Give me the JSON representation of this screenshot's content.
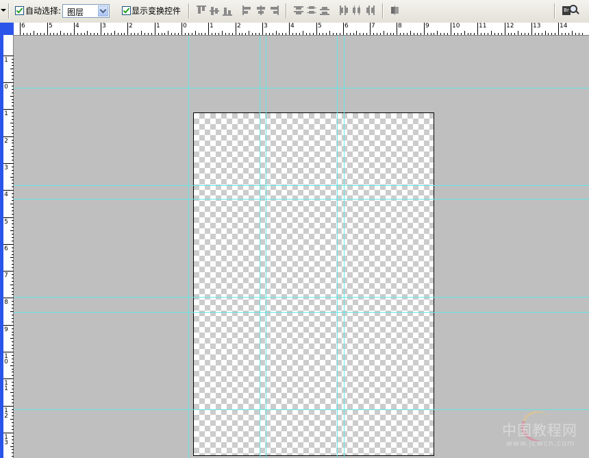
{
  "options_bar": {
    "auto_select": {
      "label": "自动选择:",
      "checked": true
    },
    "auto_select_target": {
      "value": "图层"
    },
    "show_transform_controls": {
      "label": "显示变换控件",
      "checked": true
    },
    "align_buttons": [
      "align-top-edges-icon",
      "align-vertical-centers-icon",
      "align-bottom-edges-icon",
      "align-left-edges-icon",
      "align-horizontal-centers-icon",
      "align-right-edges-icon"
    ],
    "distribute_buttons": [
      "distribute-top-icon",
      "distribute-vertical-centers-icon",
      "distribute-bottom-icon",
      "distribute-left-icon",
      "distribute-horizontal-centers-icon",
      "distribute-right-icon"
    ],
    "auto_align_button": "auto-align-layers-icon",
    "bridge_button": "go-to-bridge-icon"
  },
  "ruler_top": {
    "labels": [
      "6",
      "5",
      "4",
      "3",
      "2",
      "1",
      "0",
      "1",
      "2",
      "3",
      "4",
      "5",
      "6",
      "7",
      "8",
      "9",
      "10",
      "11",
      "12",
      "13",
      "14"
    ]
  },
  "ruler_left": {
    "labels": [
      "1",
      "0",
      "1",
      "2",
      "3",
      "4",
      "5",
      "6",
      "7",
      "8",
      "9",
      "10",
      "11",
      "12",
      "13"
    ]
  },
  "canvas": {
    "background": "#bfbfbf",
    "guide_color": "#66e6e6",
    "document_fill": "transparent-checkerboard"
  },
  "watermark": {
    "title": "中国教程网",
    "url": "www.jcwcn.com"
  }
}
